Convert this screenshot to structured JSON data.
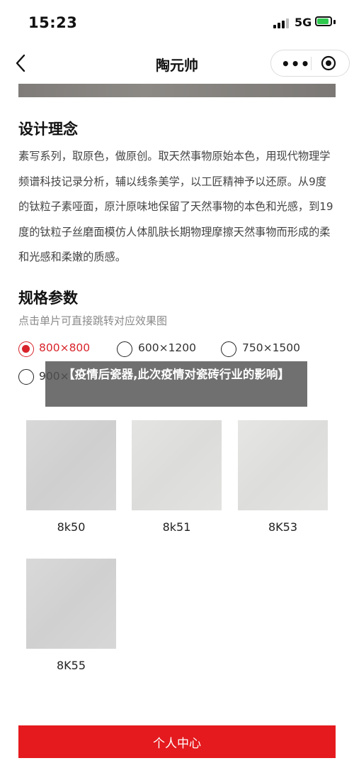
{
  "status_bar": {
    "time": "15:23",
    "network": "5G"
  },
  "nav": {
    "title": "陶元帅",
    "more_label": "•••"
  },
  "design": {
    "title": "设计理念",
    "description": "素写系列，取原色，做原创。取天然事物原始本色，用现代物理学频谱科技记录分析，辅以线条美学，以工匠精神予以还原。从9度的钛粒子素哑面，原汁原味地保留了天然事物的本色和光感，到19度的钛粒子丝磨面模仿人体肌肤长期物理摩擦天然事物而形成的柔和光感和柔嫩的质感。"
  },
  "specs": {
    "title": "规格参数",
    "hint": "点击单片可直接跳转对应效果图",
    "options": [
      {
        "label": "800×800",
        "selected": true
      },
      {
        "label": "600×1200",
        "selected": false
      },
      {
        "label": "750×1500",
        "selected": false
      },
      {
        "label": "900×",
        "selected": false
      }
    ]
  },
  "overlay_text": "【疫情后瓷器,此次疫情对瓷砖行业的影响】",
  "tiles": [
    {
      "label": "8k50"
    },
    {
      "label": "8k51"
    },
    {
      "label": "8K53"
    },
    {
      "label": "8K55"
    }
  ],
  "bottom_button": "个人中心",
  "colors": {
    "accent": "#d8232a",
    "button": "#e41a1e",
    "battery": "#2ec84e"
  },
  "icons": [
    "back-icon",
    "more-dots-icon",
    "target-icon",
    "signal-icon",
    "battery-icon"
  ]
}
